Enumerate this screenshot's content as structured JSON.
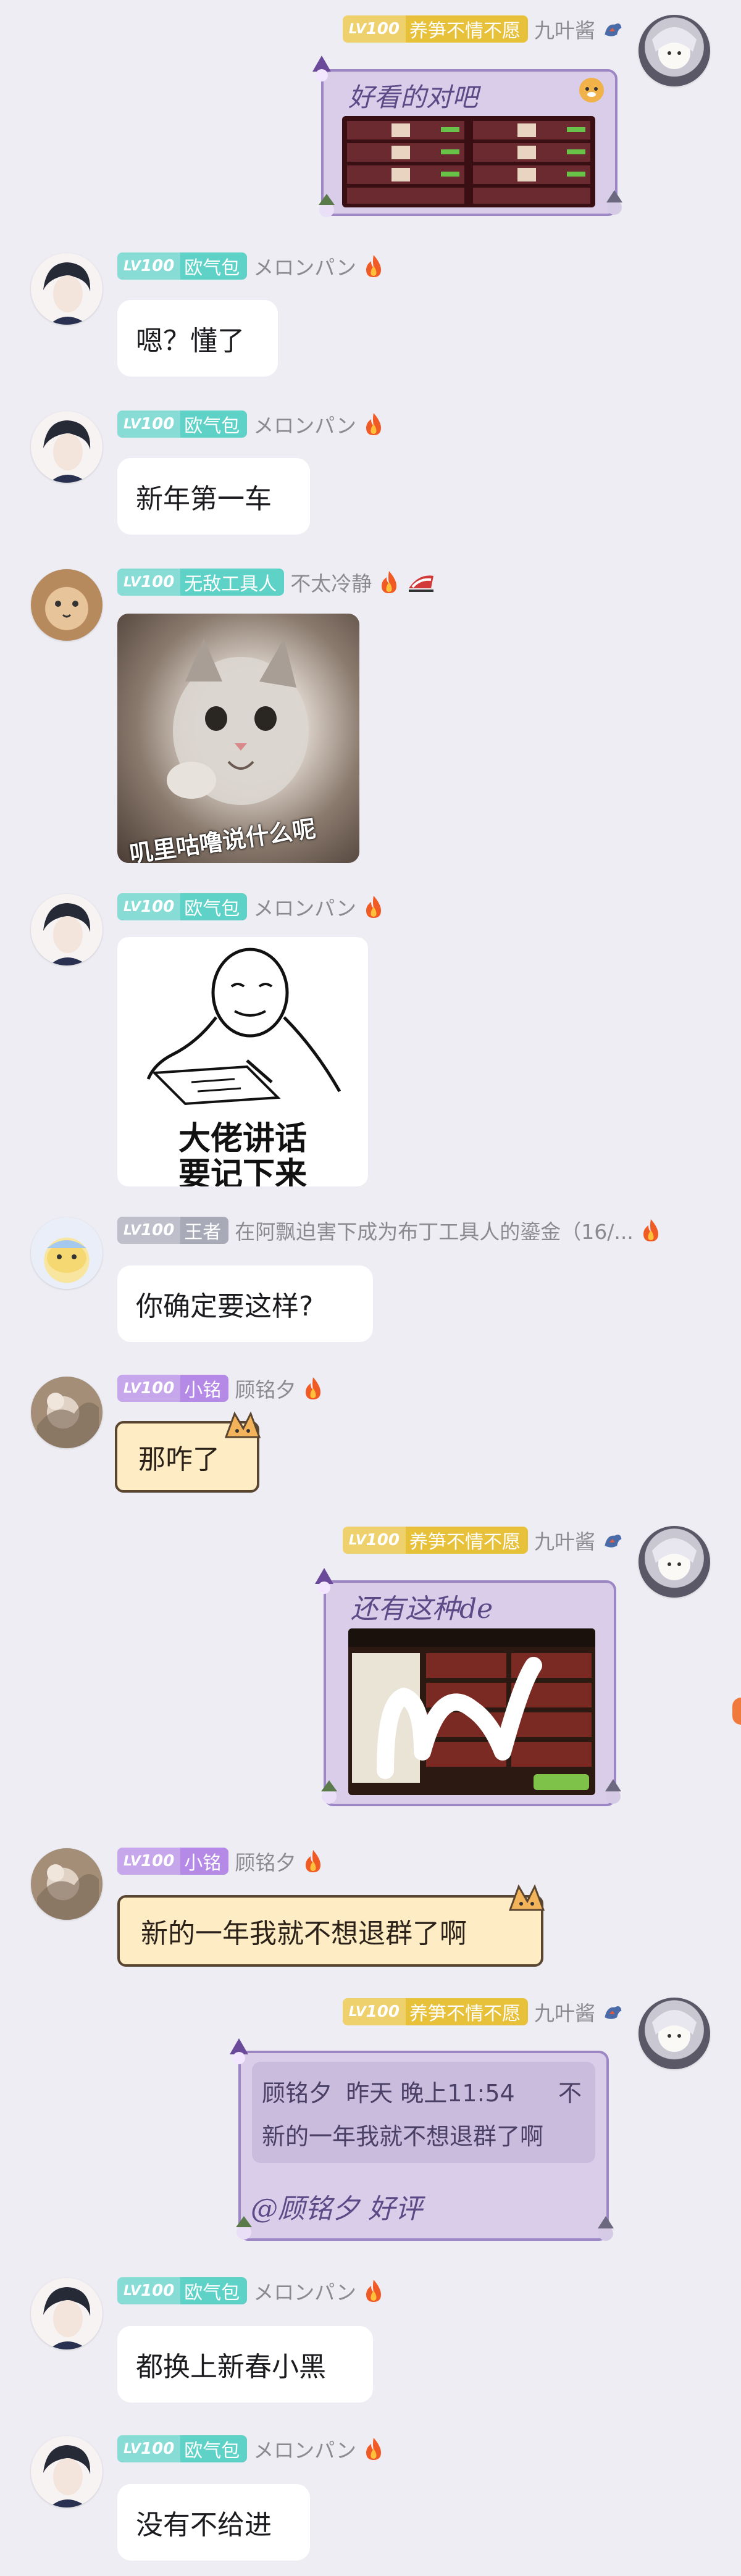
{
  "colors": {
    "badge_gold": "#e8c13b",
    "badge_teal": "#5fd2c8",
    "badge_gray": "#a9aab8",
    "badge_purple": "#b48ae6",
    "background": "#ededf3"
  },
  "messages": [
    {
      "id": "m1",
      "side": "right",
      "badge_level": "100",
      "badge_title": "养笋不情不愿",
      "nickname": "九叶酱",
      "type": "image",
      "caption": "好看的对吧"
    },
    {
      "id": "m2",
      "side": "left",
      "badge_level": "100",
      "badge_title": "欧气包",
      "nickname": "メロンパン",
      "type": "text",
      "text": "嗯？懂了"
    },
    {
      "id": "m3",
      "side": "left",
      "badge_level": "100",
      "badge_title": "欧气包",
      "nickname": "メロンパン",
      "type": "text",
      "text": "新年第一车"
    },
    {
      "id": "m4",
      "side": "left",
      "badge_level": "100",
      "badge_title": "无敌工具人",
      "nickname": "不太冷静",
      "type": "sticker",
      "sticker_text": "叽里咕噜说什么呢"
    },
    {
      "id": "m5",
      "side": "left",
      "badge_level": "100",
      "badge_title": "欧气包",
      "nickname": "メロンパン",
      "type": "sticker",
      "sticker_text_line1": "大佬讲话",
      "sticker_text_line2": "要记下来"
    },
    {
      "id": "m6",
      "side": "left",
      "badge_level": "100",
      "badge_title": "王者",
      "nickname": "在阿飘迫害下成为布丁工具人的鎏金（16/...",
      "type": "text",
      "text": "你确定要这样?"
    },
    {
      "id": "m7",
      "side": "left",
      "badge_level": "100",
      "badge_title": "小铭",
      "nickname": "顾铭夕",
      "type": "text",
      "text": "那咋了"
    },
    {
      "id": "m8",
      "side": "right",
      "badge_level": "100",
      "badge_title": "养笋不情不愿",
      "nickname": "九叶酱",
      "type": "image",
      "caption": "还有这种de"
    },
    {
      "id": "m9",
      "side": "left",
      "badge_level": "100",
      "badge_title": "小铭",
      "nickname": "顾铭夕",
      "type": "text",
      "text": "新的一年我就不想退群了啊"
    },
    {
      "id": "m10",
      "side": "right",
      "badge_level": "100",
      "badge_title": "养笋不情不愿",
      "nickname": "九叶酱",
      "type": "reply",
      "quote_author": "顾铭夕",
      "quote_time": "昨天 晚上11:54",
      "quote_more": "不",
      "quote_text": "新的一年我就不想退群了啊",
      "reply_text": "@顾铭夕 好评"
    },
    {
      "id": "m11",
      "side": "left",
      "badge_level": "100",
      "badge_title": "欧气包",
      "nickname": "メロンパン",
      "type": "text",
      "text": "都换上新春小黑"
    },
    {
      "id": "m12",
      "side": "left",
      "badge_level": "100",
      "badge_title": "欧气包",
      "nickname": "メロンパン",
      "type": "text",
      "text": "没有不给进"
    }
  ],
  "badge_lv_prefix": "LV"
}
